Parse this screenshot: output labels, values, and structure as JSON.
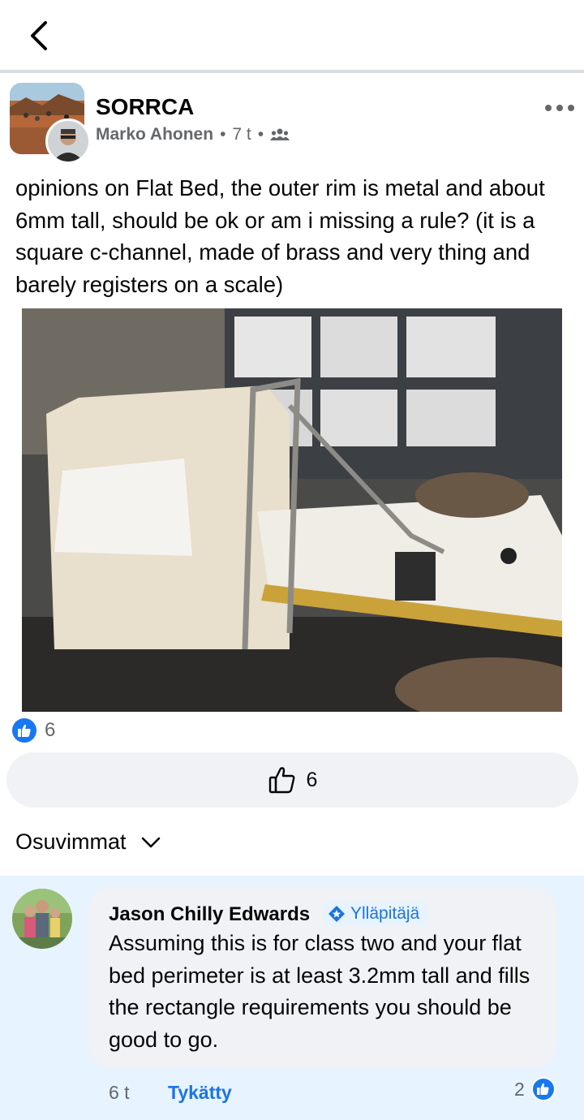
{
  "header": {
    "back_icon": "chevron-left-icon"
  },
  "post": {
    "group_name": "SORRCA",
    "author": "Marko Ahonen",
    "time": "7 t",
    "separator": "•",
    "audience_icon": "group-members-icon",
    "more_icon": "more-dots-icon",
    "text": "opinions on Flat Bed, the outer rim is metal and about 6mm tall, should be ok or am i missing a rule? (it is a square c-channel, made of brass and very thing and barely registers on a scale)",
    "reaction_count": "6",
    "like_button_count": "6"
  },
  "comments": {
    "sort_label": "Osuvimmat",
    "items": [
      {
        "author": "Jason Chilly Edwards",
        "badge": "Ylläpitäjä",
        "text": "Assuming this is for class two and your flat bed perimeter is at least 3.2mm tall and fills the rectangle requirements you should be good to go.",
        "time": "6 t",
        "liked_label": "Tykätty",
        "like_count": "2"
      }
    ]
  },
  "colors": {
    "accent": "#1877f2",
    "link": "#1b74e4",
    "muted": "#65676b",
    "comment_bg": "#e7f3ff"
  }
}
